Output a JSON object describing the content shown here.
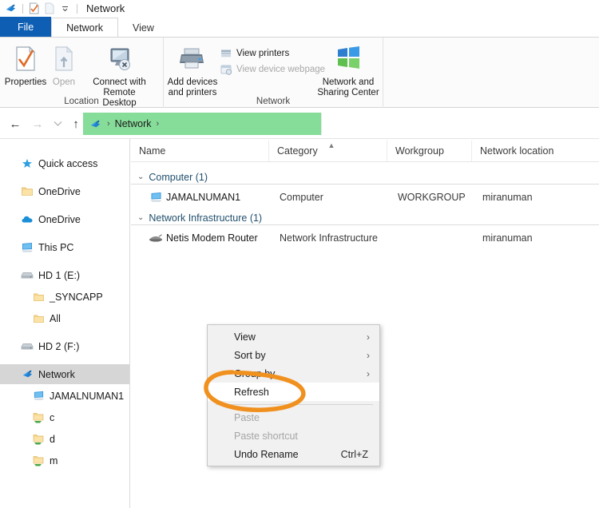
{
  "window": {
    "title": "Network",
    "quick_access": [
      {
        "name": "network-icon",
        "label": "Network"
      },
      {
        "name": "properties-icon",
        "label": "Properties"
      },
      {
        "name": "open-icon",
        "label": "Open"
      },
      {
        "name": "customize-chevron-icon",
        "label": "Customize Quick Access Toolbar"
      }
    ]
  },
  "tabs": [
    {
      "label": "File",
      "state": "file"
    },
    {
      "label": "Network",
      "state": "active"
    },
    {
      "label": "View",
      "state": "inactive"
    }
  ],
  "ribbon": {
    "groups": [
      {
        "label": "Location",
        "big_buttons": [
          {
            "label_line1": "Properties",
            "label_line2": "",
            "icon": "properties-checkmark-icon",
            "enabled": true
          },
          {
            "label_line1": "Open",
            "label_line2": "",
            "icon": "open-page-icon",
            "enabled": false
          },
          {
            "label_line1": "Connect with Remote",
            "label_line2": "Desktop Connection",
            "icon": "remote-desktop-icon",
            "enabled": true
          }
        ]
      },
      {
        "label": "Network",
        "big_buttons": [
          {
            "label_line1": "Add devices",
            "label_line2": "and printers",
            "icon": "printer-icon",
            "enabled": true
          },
          {
            "label_line1": "Network and",
            "label_line2": "Sharing Center",
            "icon": "network-sharing-icon",
            "enabled": true
          }
        ],
        "small_buttons": [
          {
            "label": "View printers",
            "icon": "view-printers-icon",
            "enabled": true
          },
          {
            "label": "View device webpage",
            "icon": "view-device-webpage-icon",
            "enabled": false
          }
        ]
      }
    ]
  },
  "navigation": {
    "back": "←",
    "forward": "→",
    "recent": "⌄",
    "up": "↑",
    "address_crumbs": [
      "Network"
    ],
    "address_selected": true,
    "address_highlight_color": "#86dd99"
  },
  "sidebar": {
    "items": [
      {
        "label": "Quick access",
        "icon": "star-icon",
        "indent": 0,
        "selected": false
      },
      {
        "label": "OneDrive",
        "icon": "folder-icon",
        "indent": 0,
        "selected": false
      },
      {
        "label": "OneDrive",
        "icon": "cloud-icon",
        "indent": 0,
        "selected": false
      },
      {
        "label": "This PC",
        "icon": "computer-icon",
        "indent": 0,
        "selected": false
      },
      {
        "label": "HD 1 (E:)",
        "icon": "drive-icon",
        "indent": 0,
        "selected": false
      },
      {
        "label": "_SYNCAPP",
        "icon": "folder-icon",
        "indent": 1,
        "selected": false
      },
      {
        "label": "All",
        "icon": "folder-icon",
        "indent": 1,
        "selected": false
      },
      {
        "label": "HD 2 (F:)",
        "icon": "drive-icon",
        "indent": 0,
        "selected": false
      },
      {
        "label": "Network",
        "icon": "network-icon",
        "indent": 0,
        "selected": true
      },
      {
        "label": "JAMALNUMAN1",
        "icon": "computer-icon",
        "indent": 1,
        "selected": false
      },
      {
        "label": "c",
        "icon": "shared-folder-icon",
        "indent": 2,
        "selected": false
      },
      {
        "label": "d",
        "icon": "shared-folder-icon",
        "indent": 2,
        "selected": false
      },
      {
        "label": "m",
        "icon": "shared-folder-icon",
        "indent": 2,
        "selected": false
      }
    ]
  },
  "filelist": {
    "columns": [
      {
        "label": "Name",
        "sorted": false
      },
      {
        "label": "Category",
        "sorted": true,
        "sort_direction": "asc"
      },
      {
        "label": "Workgroup",
        "sorted": false
      },
      {
        "label": "Network location",
        "sorted": false
      }
    ],
    "groups": [
      {
        "header": "Computer (1)",
        "expanded": true,
        "rows": [
          {
            "name": "JAMALNUMAN1",
            "category": "Computer",
            "workgroup": "WORKGROUP",
            "location": "miranuman",
            "icon": "computer-icon"
          }
        ]
      },
      {
        "header": "Network Infrastructure (1)",
        "expanded": true,
        "rows": [
          {
            "name": "Netis Modem Router",
            "category": "Network Infrastructure",
            "workgroup": "",
            "location": "miranuman",
            "icon": "router-icon"
          }
        ]
      }
    ]
  },
  "context_menu": {
    "items": [
      {
        "label": "View",
        "submenu": true,
        "enabled": true,
        "highlighted": false,
        "accel": ""
      },
      {
        "label": "Sort by",
        "submenu": true,
        "enabled": true,
        "highlighted": false,
        "accel": ""
      },
      {
        "label": "Group by",
        "submenu": true,
        "enabled": true,
        "highlighted": false,
        "accel": ""
      },
      {
        "label": "Refresh",
        "submenu": false,
        "enabled": true,
        "highlighted": true,
        "accel": ""
      },
      {
        "label": "Paste",
        "submenu": false,
        "enabled": false,
        "highlighted": false,
        "accel": ""
      },
      {
        "label": "Paste shortcut",
        "submenu": false,
        "enabled": false,
        "highlighted": false,
        "accel": ""
      },
      {
        "label": "Undo Rename",
        "submenu": false,
        "enabled": true,
        "highlighted": false,
        "accel": "Ctrl+Z"
      }
    ],
    "separator_after_index": 3
  },
  "annotation": {
    "shape": "hand-drawn-ellipse",
    "color": "#f0901e",
    "target": "Refresh"
  }
}
